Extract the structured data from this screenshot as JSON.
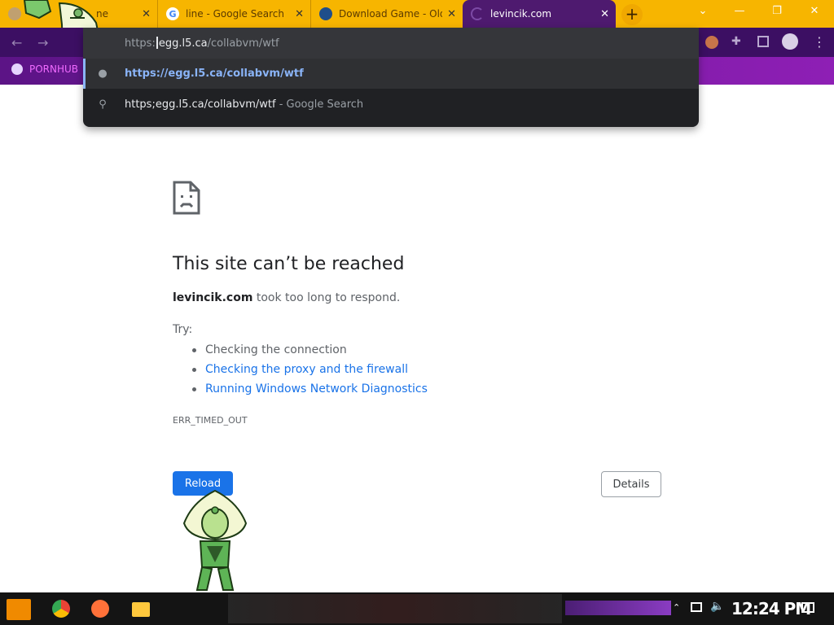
{
  "tabs": [
    {
      "title": "ne",
      "close": "✕"
    },
    {
      "title": "line - Google Search",
      "close": "✕",
      "favicon": "G"
    },
    {
      "title": "Download Game - Old",
      "close": "✕"
    },
    {
      "title": "levincik.com",
      "close": "✕"
    }
  ],
  "new_tab": "+",
  "window": {
    "minimize": "—",
    "restore": "❐",
    "close": "✕",
    "chevron": "⌄"
  },
  "bookmarks": [
    {
      "label": "PORNHUB"
    }
  ],
  "omnibox": {
    "input_prefix": "https:",
    "input_host": "egg.l5.ca",
    "input_path": "/collabvm/wtf",
    "suggestions": [
      {
        "host": "https://egg.l5.ca/collabvm/wtf",
        "suffix": "",
        "icon": "globe-icon"
      },
      {
        "host": "https;egg.l5.ca/collabvm/wtf",
        "suffix": " - Google Search",
        "icon": "search-icon"
      }
    ]
  },
  "error": {
    "title": "This site can’t be reached",
    "host": "levincik.com",
    "message": " took too long to respond.",
    "try_label": "Try:",
    "suggestions": [
      {
        "text": "Checking the connection",
        "link": false
      },
      {
        "text": "Checking the proxy and the firewall",
        "link": true
      },
      {
        "text": "Running Windows Network Diagnostics",
        "link": true
      }
    ],
    "code": "ERR_TIMED_OUT",
    "reload_label": "Reload",
    "details_label": "Details"
  },
  "taskbar": {
    "time": "12:24 PM"
  },
  "colors": {
    "tab_strip": "#f7b500",
    "active_tab": "#4e1a6f",
    "toolbar": "#3c0f63",
    "bookmark_bar": "#7a1aa3",
    "link_blue": "#1a73e8",
    "omnibox_bg": "#202124"
  }
}
